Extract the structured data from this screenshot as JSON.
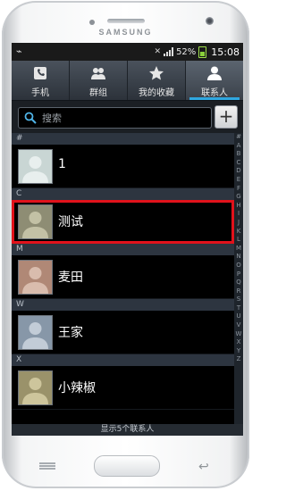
{
  "device": {
    "brand": "SAMSUNG"
  },
  "status_bar": {
    "battery": "52%",
    "time": "15:08"
  },
  "tabs": [
    {
      "label": "手机",
      "icon": "phone-icon"
    },
    {
      "label": "群组",
      "icon": "group-icon"
    },
    {
      "label": "我的收藏",
      "icon": "star-icon"
    },
    {
      "label": "联系人",
      "icon": "person-icon",
      "active": true
    }
  ],
  "search": {
    "placeholder": "搜索",
    "value": ""
  },
  "add_button": {
    "label": "+"
  },
  "contacts": [
    {
      "section": "#",
      "name": "1"
    },
    {
      "section": "C",
      "name": "测试",
      "selected": true
    },
    {
      "section": "M",
      "name": "麦田"
    },
    {
      "section": "W",
      "name": "王家"
    },
    {
      "section": "X",
      "name": "小辣椒"
    }
  ],
  "index_letters": [
    "#",
    "A",
    "B",
    "C",
    "D",
    "E",
    "F",
    "G",
    "H",
    "I",
    "J",
    "K",
    "L",
    "M",
    "N",
    "O",
    "P",
    "Q",
    "R",
    "S",
    "T",
    "U",
    "V",
    "W",
    "X",
    "Y",
    "Z"
  ],
  "footer": {
    "text": "显示5个联系人"
  },
  "colors": {
    "accent": "#2fa7e0",
    "highlight": "#e1121b",
    "section_bg": "#2d3540"
  }
}
